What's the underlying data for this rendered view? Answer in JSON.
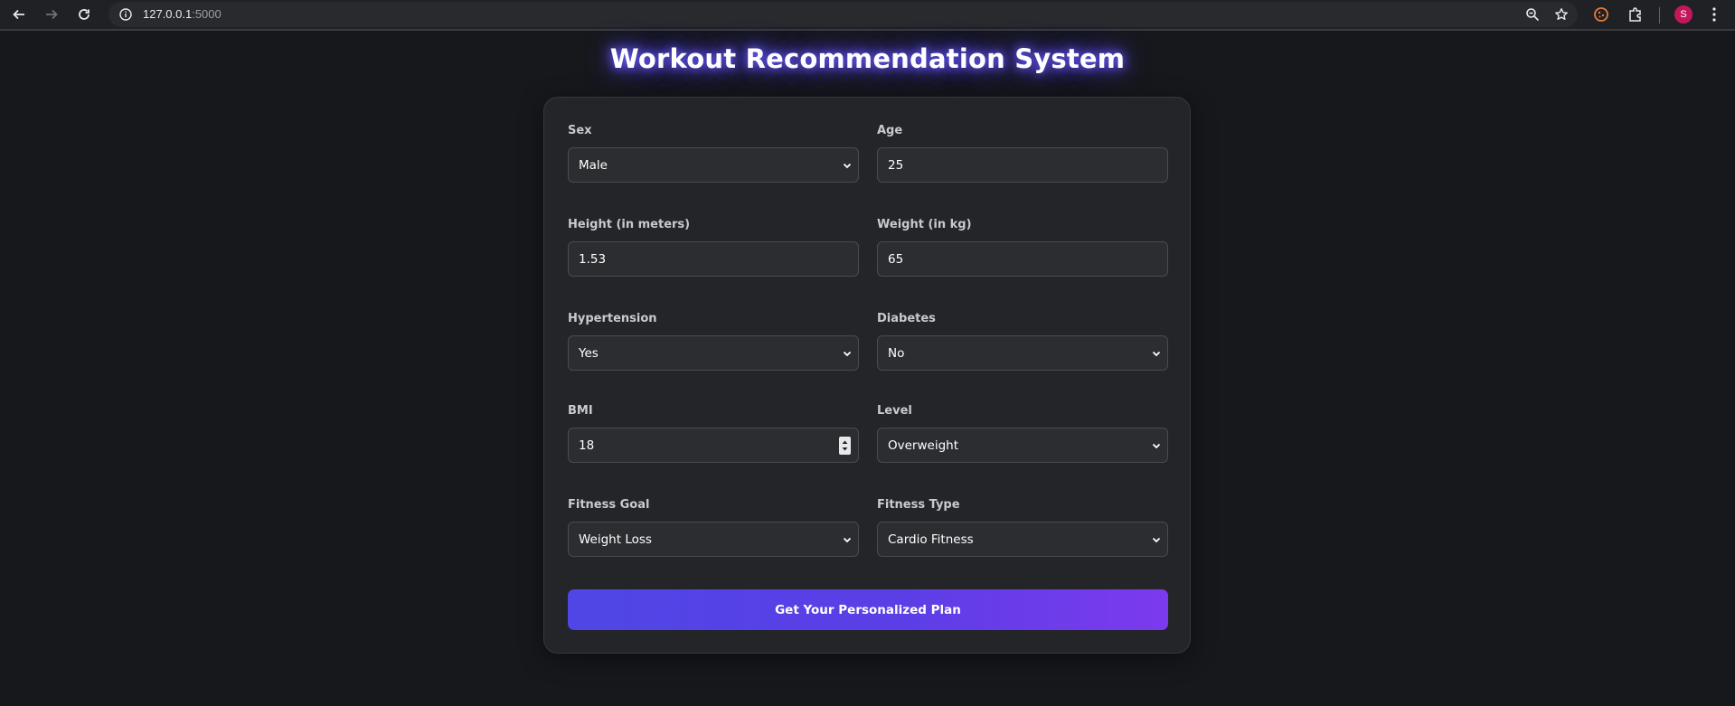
{
  "browser": {
    "url_host": "127.0.0.1",
    "url_port": ":5000",
    "profile_initial": "S"
  },
  "page": {
    "title": "Workout Recommendation System"
  },
  "form": {
    "sex": {
      "label": "Sex",
      "value": "Male"
    },
    "age": {
      "label": "Age",
      "value": "25"
    },
    "height": {
      "label": "Height (in meters)",
      "value": "1.53"
    },
    "weight": {
      "label": "Weight (in kg)",
      "value": "65"
    },
    "hypertension": {
      "label": "Hypertension",
      "value": "Yes"
    },
    "diabetes": {
      "label": "Diabetes",
      "value": "No"
    },
    "bmi": {
      "label": "BMI",
      "value": "18"
    },
    "level": {
      "label": "Level",
      "value": "Overweight"
    },
    "fitness_goal": {
      "label": "Fitness Goal",
      "value": "Weight Loss"
    },
    "fitness_type": {
      "label": "Fitness Type",
      "value": "Cardio Fitness"
    },
    "submit_label": "Get Your Personalized Plan"
  },
  "colors": {
    "background": "#17181c",
    "card": "#242529",
    "accent_start": "#4f46e5",
    "accent_end": "#7c3aed",
    "title_glow": "#6b5cff"
  }
}
